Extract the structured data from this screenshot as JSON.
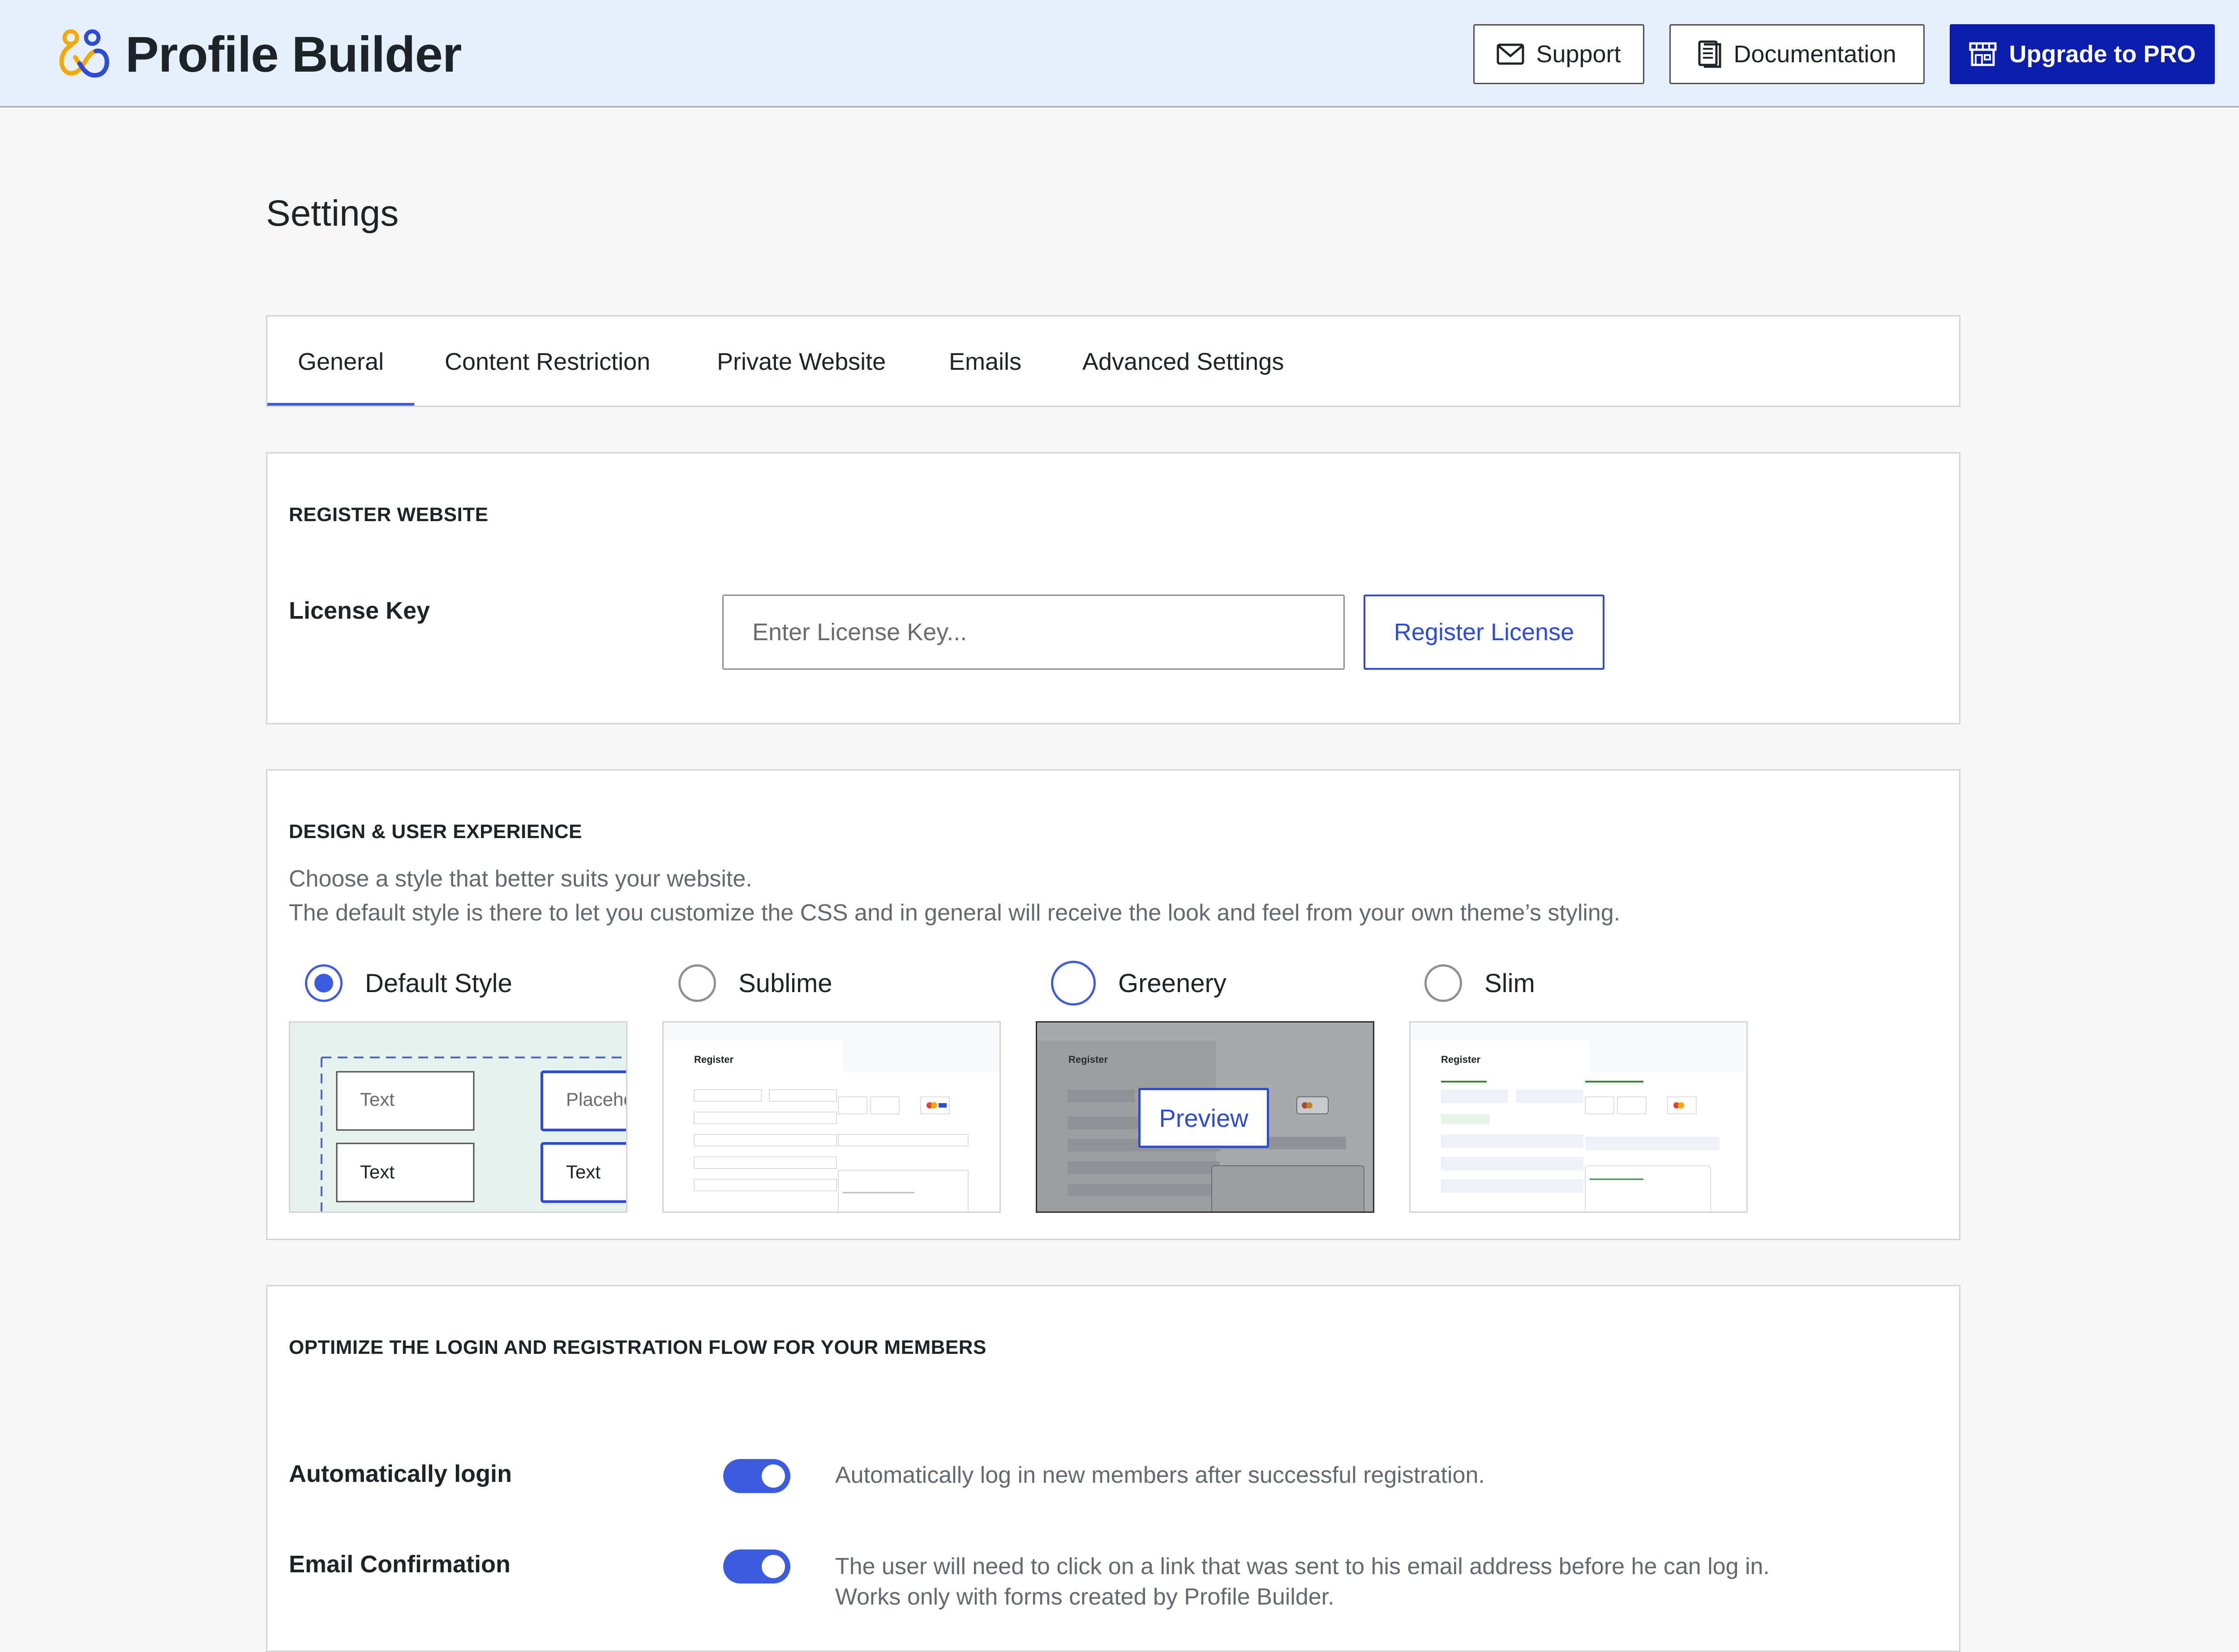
{
  "header": {
    "brand": "Profile Builder",
    "support_label": "Support",
    "documentation_label": "Documentation",
    "upgrade_label": "Upgrade to PRO"
  },
  "page_title": "Settings",
  "tabs": [
    {
      "label": "General",
      "active": true
    },
    {
      "label": "Content Restriction"
    },
    {
      "label": "Private Website"
    },
    {
      "label": "Emails"
    },
    {
      "label": "Advanced Settings"
    }
  ],
  "register": {
    "title": "REGISTER WEBSITE",
    "license_label": "License Key",
    "license_placeholder": "Enter License Key...",
    "license_value": "",
    "register_button": "Register License"
  },
  "design": {
    "title": "DESIGN & USER EXPERIENCE",
    "desc1": "Choose a style that better suits your website.",
    "desc2": "The default style is there to let you customize the CSS and in general will receive the look and feel from your own theme’s styling.",
    "selected_style": "Default Style",
    "styles": [
      {
        "label": "Default Style"
      },
      {
        "label": "Sublime"
      },
      {
        "label": "Greenery"
      },
      {
        "label": "Slim"
      }
    ],
    "preview_label": "Preview",
    "default_thumb": {
      "text1": "Text",
      "text2": "Placeho",
      "text3": "Text",
      "text4": "Text"
    },
    "mini_form_title": "Register"
  },
  "flow": {
    "title": "OPTIMIZE THE LOGIN AND REGISTRATION FLOW FOR YOUR MEMBERS",
    "auto_login_label": "Automatically login",
    "auto_login_desc": "Automatically log in new members after successful registration.",
    "auto_login_on": true,
    "email_conf_label": "Email Confirmation",
    "email_conf_desc1": "The user will need to click on a link that was sent to his email address before he can log in.",
    "email_conf_desc2": "Works only with forms created by Profile Builder.",
    "email_conf_on": true
  },
  "colors": {
    "accent": "#3b5ce0",
    "pro_button": "#0c1cac",
    "header_bg": "#e6f0fc"
  }
}
